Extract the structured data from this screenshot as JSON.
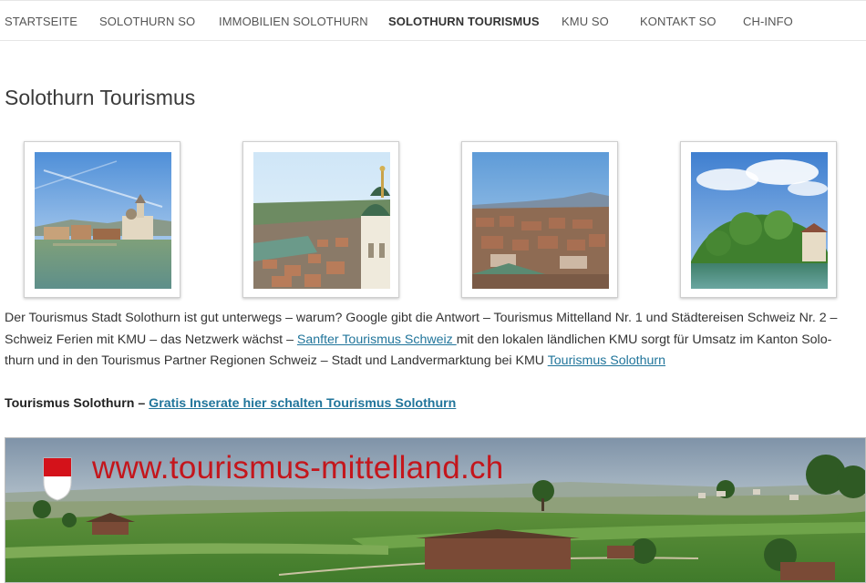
{
  "nav": {
    "items": [
      {
        "label": "STARTSEITE",
        "active": false
      },
      {
        "label": "SOLOTHURN SO",
        "active": false
      },
      {
        "label": "IMMOBILIEN SOLOTHURN",
        "active": false
      },
      {
        "label": "SOLOTHURN TOURISMUS",
        "active": true
      },
      {
        "label": "KMU SO",
        "active": false
      },
      {
        "label": "KONTAKT SO",
        "active": false
      },
      {
        "label": "CH-INFO",
        "active": false
      }
    ]
  },
  "page": {
    "title": "Solothurn Tourismus"
  },
  "paragraph": {
    "line1": "Der Tourismus Stadt Solothurn ist gut unterwegs – warum? Google gibt die Antwort – Tourismus Mittelland Nr. 1  und Städtereisen Schweiz Nr. 2 –",
    "line2_before": "Schweiz Ferien mit KMU – das Netzwerk wächst – ",
    "link1": "Sanfter Tourismus Schweiz ",
    "line2_after": "mit den lokalen ländlichen KMU sorgt für Umsatz im Kanton Solo-",
    "line3_before": "thurn und in den Tourismus Partner Regionen Schweiz – Stadt und Landvermarktung bei KMU ",
    "link2": "Tourismus Solothurn"
  },
  "lead": {
    "label": "Tourismus Solothurn – ",
    "link": "Gratis Inserate hier schalten Tourismus Solothurn"
  },
  "banner": {
    "text": "www.tourismus-mittelland.ch"
  },
  "colors": {
    "link": "#21759b",
    "banner_text": "#c4161c",
    "crest_red": "#d4121a"
  }
}
